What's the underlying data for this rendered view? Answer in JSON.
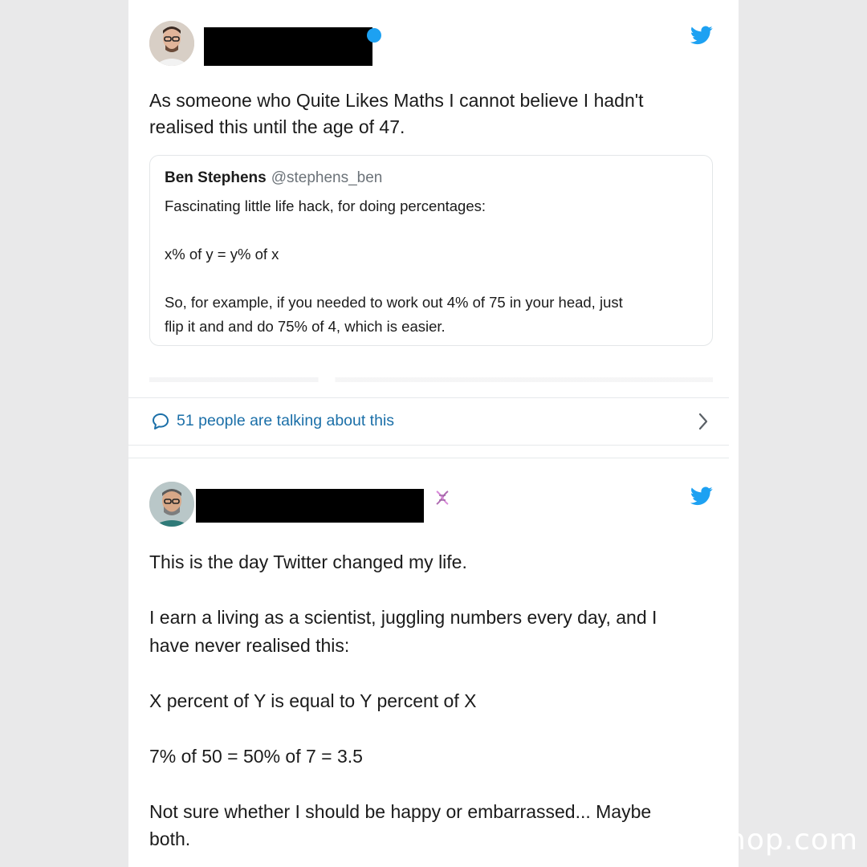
{
  "tweet1": {
    "text": "As someone who Quite Likes Maths I cannot believe I hadn't\nrealised this until the age of 47.",
    "quote": {
      "name": "Ben Stephens",
      "handle": "@stephens_ben",
      "text": "Fascinating little life hack, for doing percentages:\n\nx% of y = y% of x\n\nSo, for example, if you needed to work out 4% of 75 in your head, just\nflip it and and do 75% of 4, which is easier."
    },
    "talk_label": "51 people are talking about this"
  },
  "tweet2": {
    "text": "This is the day Twitter changed my life.\n\nI earn a living as a scientist, juggling numbers every day, and I\nhave never realised this:\n\nX percent of Y is equal to Y percent of X\n\n7% of 50 = 50% of 7 = 3.5\n\nNot sure whether I should be happy or embarrassed... Maybe\nboth."
  },
  "watermark": "nop.com",
  "colors": {
    "twitter_blue": "#1da1f2",
    "link_blue": "#1b6fa8",
    "page_bg": "#e9e9ea"
  },
  "icons": {
    "brand": "twitter-bird-icon",
    "talk": "speech-bubble-icon",
    "chevron": "chevron-right-icon"
  }
}
